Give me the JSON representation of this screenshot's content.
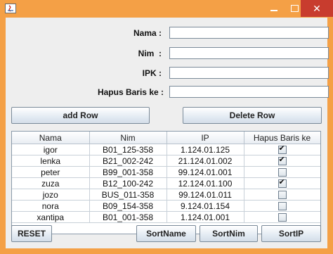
{
  "window": {
    "close_glyph": "✕"
  },
  "form": {
    "nama_label": "Nama :",
    "nim_label": "Nim  :",
    "ipk_label": "IPK :",
    "hapus_label": "Hapus Baris ke :",
    "nama_value": "",
    "nim_value": "",
    "ipk_value": "",
    "hapus_value": ""
  },
  "buttons": {
    "add_row": "add Row",
    "delete_row": "Delete Row",
    "reset": "RESET",
    "sort_name": "SortName",
    "sort_nim": "SortNim",
    "sort_ip": "SortIP"
  },
  "table": {
    "columns": [
      "Nama",
      "Nim",
      "IP",
      "Hapus Baris ke"
    ],
    "rows": [
      {
        "nama": "igor",
        "nim": "B01_125-358",
        "ip": "1.124.01.125",
        "hapus": true
      },
      {
        "nama": "lenka",
        "nim": "B21_002-242",
        "ip": "21.124.01.002",
        "hapus": true
      },
      {
        "nama": "peter",
        "nim": "B99_001-358",
        "ip": "99.124.01.001",
        "hapus": false
      },
      {
        "nama": "zuza",
        "nim": "B12_100-242",
        "ip": "12.124.01.100",
        "hapus": true
      },
      {
        "nama": "jozo",
        "nim": "BUS_011-358",
        "ip": "99.124.01.011",
        "hapus": false
      },
      {
        "nama": "nora",
        "nim": "B09_154-358",
        "ip": "9.124.01.154",
        "hapus": false
      },
      {
        "nama": "xantipa",
        "nim": "B01_001-358",
        "ip": "1.124.01.001",
        "hapus": false
      }
    ]
  },
  "colors": {
    "frame": "#f4a046",
    "close": "#c83c2e",
    "panel": "#eeeeee"
  }
}
